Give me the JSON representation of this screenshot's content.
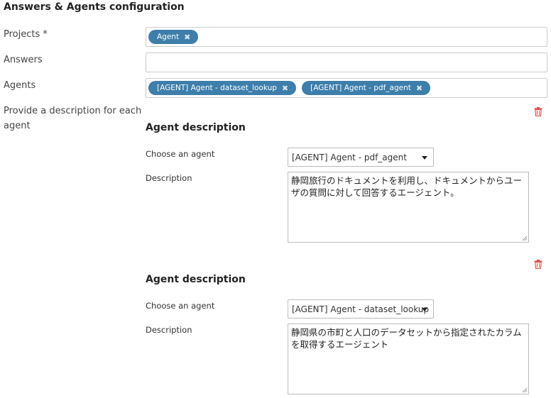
{
  "title": "Answers & Agents configuration",
  "projects": {
    "label": "Projects *",
    "tags": [
      {
        "label": "Agent"
      }
    ]
  },
  "answers": {
    "label": "Answers",
    "value": ""
  },
  "agents": {
    "label": "Agents",
    "tags": [
      {
        "label": "[AGENT] Agent - dataset_lookup"
      },
      {
        "label": "[AGENT] Agent - pdf_agent"
      }
    ]
  },
  "description_prompt": {
    "line1": "Provide a description for each",
    "line2": "agent"
  },
  "remove_tag_glyph": "✖",
  "agent_descriptions": [
    {
      "title": "Agent description",
      "choose_label": "Choose an agent",
      "selected_agent": "[AGENT] Agent - pdf_agent",
      "description_label": "Description",
      "description": "静岡旅行のドキュメントを利用し、ドキュメントからユーザの質問に対して回答するエージェント。"
    },
    {
      "title": "Agent description",
      "choose_label": "Choose an agent",
      "selected_agent": "[AGENT] Agent - dataset_lookup",
      "description_label": "Description",
      "description": "静岡県の市町と人口のデータセットから指定されたカラムを取得するエージェント"
    }
  ],
  "colors": {
    "tag_bg": "#3d7eab",
    "trash": "#d9534f"
  }
}
